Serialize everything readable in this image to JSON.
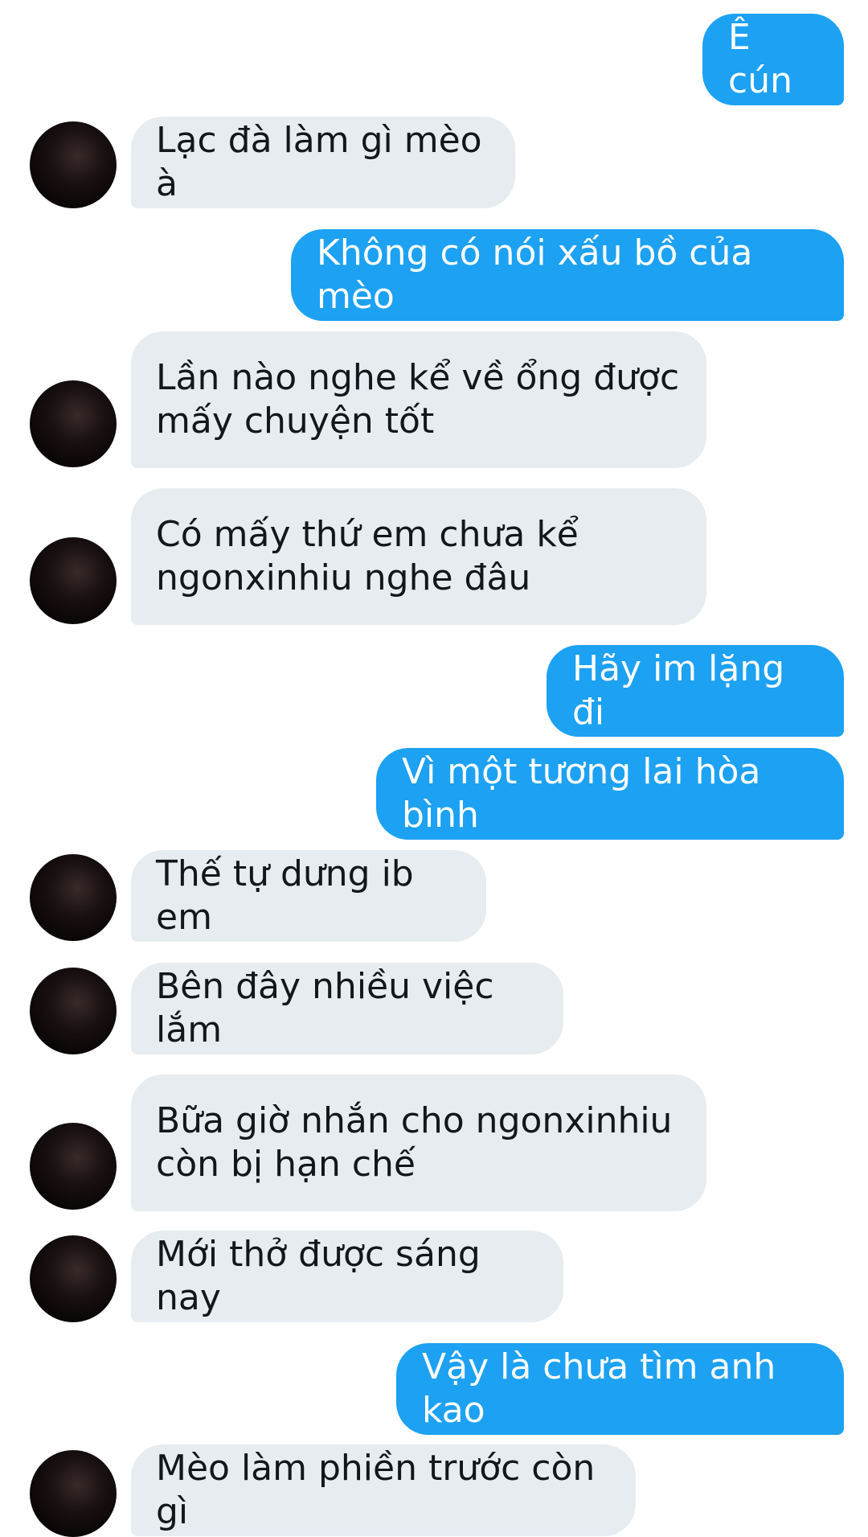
{
  "messages": [
    {
      "side": "sent",
      "text": "Ê cún"
    },
    {
      "side": "received",
      "text": "Lạc đà làm gì mèo à"
    },
    {
      "side": "sent",
      "text": "Không có nói xấu bồ của mèo"
    },
    {
      "side": "received",
      "text": "Lần nào nghe kể về ổng được\nmấy chuyện tốt"
    },
    {
      "side": "received",
      "text": "Có mấy thứ em chưa kể\nngonxinhiu nghe đâu"
    },
    {
      "side": "sent",
      "text": "Hãy im lặng đi"
    },
    {
      "side": "sent",
      "text": "Vì một tương lai hòa bình"
    },
    {
      "side": "received",
      "text": "Thế tự dưng ib em"
    },
    {
      "side": "received",
      "text": "Bên đây nhiều việc lắm"
    },
    {
      "side": "received",
      "text": "Bữa giờ nhắn cho ngonxinhiu\ncòn bị hạn chế"
    },
    {
      "side": "received",
      "text": "Mới thở được sáng nay"
    },
    {
      "side": "sent",
      "text": "Vậy là chưa tìm anh kao"
    },
    {
      "side": "received",
      "text": "Mèo làm phiền trước còn gì"
    }
  ],
  "colors": {
    "sent_bubble": "#1da1f2",
    "received_bubble": "#e6ecf0",
    "received_text": "#14171a",
    "background": "#ffffff"
  },
  "icons": {
    "avatar": "avatar-photo"
  }
}
